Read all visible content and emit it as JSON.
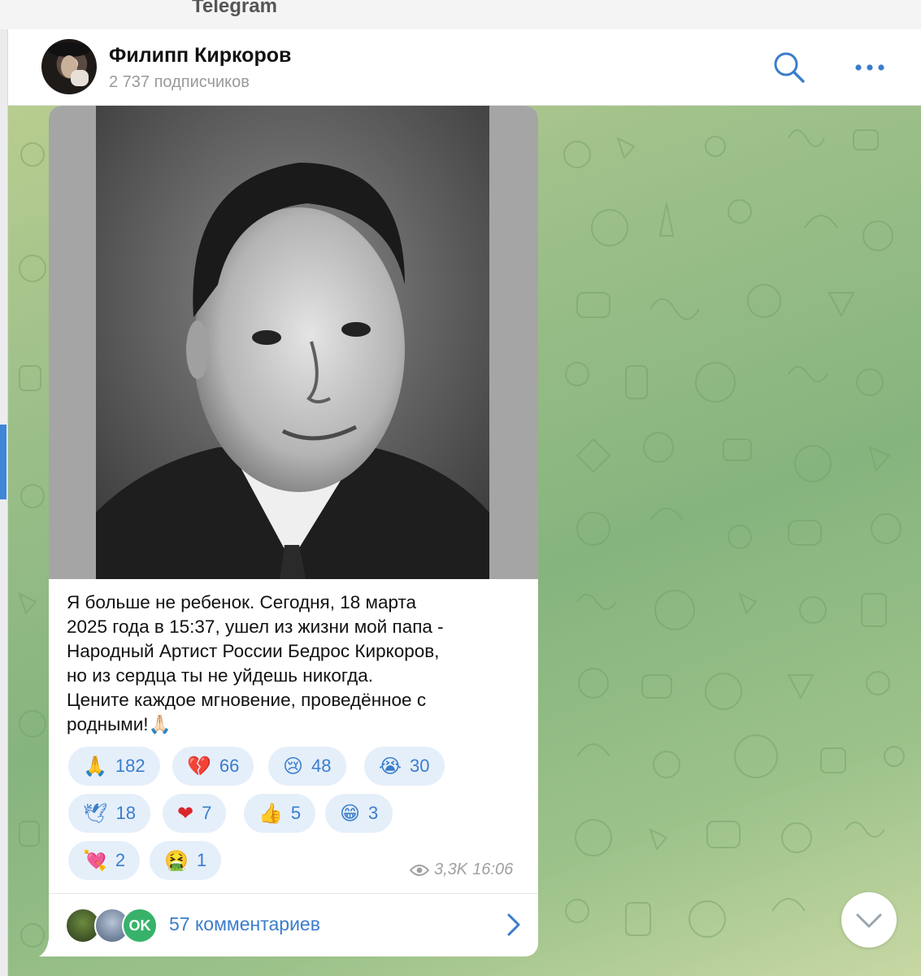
{
  "app": {
    "title": "Telegram"
  },
  "header": {
    "channel_name": "Филипп Киркоров",
    "subscribers": "2 737 подписчиков"
  },
  "post": {
    "text_lines": [
      "Я больше не ребенок. Сегодня, 18 марта",
      "2025 года в 15:37, ушел из жизни мой папа -",
      "Народный Артист России Бедрос Киркоров,",
      "но из сердца ты не уйдешь никогда.",
      "Цените каждое мгновение, проведённое с",
      "родными!🙏🏻"
    ],
    "reactions": [
      {
        "emoji": "🙏",
        "count": "182"
      },
      {
        "emoji": "💔",
        "count": "66"
      },
      {
        "emoji": "😢",
        "count": "48"
      },
      {
        "emoji": "😭",
        "count": "30"
      },
      {
        "emoji": "🕊",
        "count": "18"
      },
      {
        "emoji": "❤",
        "count": "7"
      },
      {
        "emoji": "👍",
        "count": "5"
      },
      {
        "emoji": "😁",
        "count": "3"
      },
      {
        "emoji": "💘",
        "count": "2"
      },
      {
        "emoji": "🤮",
        "count": "1"
      }
    ],
    "views": "3,3K",
    "time": "16:06",
    "comments": {
      "label": "57 комментариев",
      "avatar_text": "OK"
    }
  },
  "colors": {
    "accent": "#3a7dcc",
    "reaction_bg": "#e5effa",
    "chat_bg": "#9ec08a"
  }
}
